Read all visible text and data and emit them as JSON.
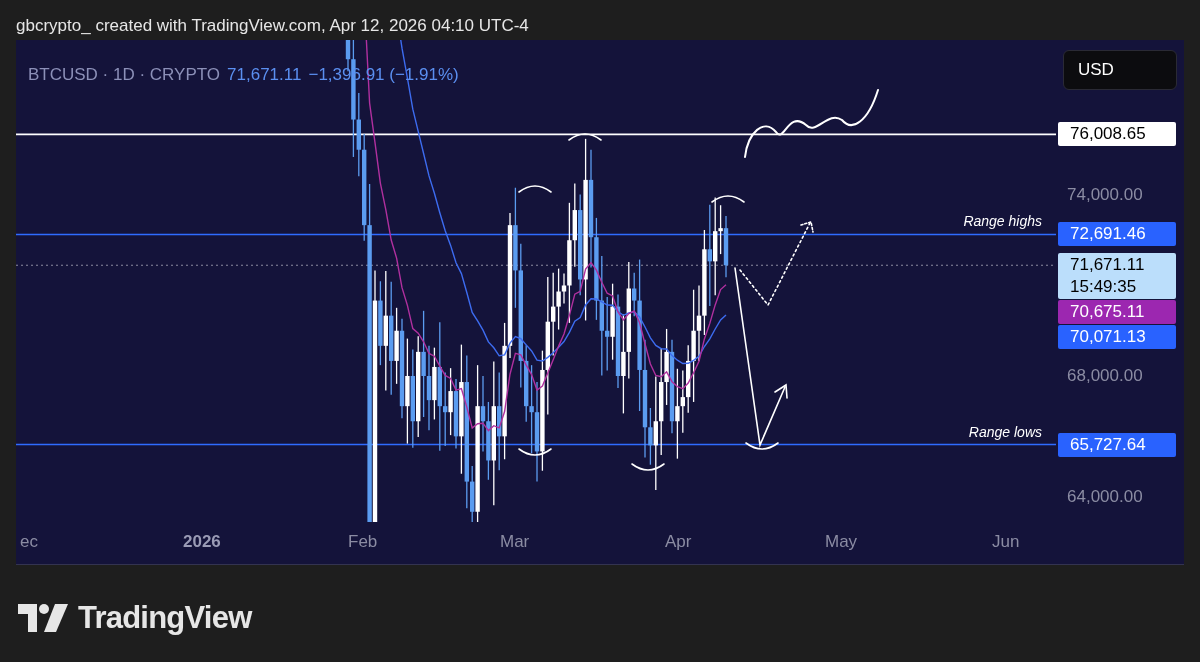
{
  "header": {
    "caption": "gbcrypto_ created with TradingView.com, Apr 12, 2026 04:10 UTC-4"
  },
  "legend": {
    "symbol": "BTCUSD · 1D · CRYPTO",
    "price": "71,671.11",
    "change": "−1,396.91 (−1.91%)"
  },
  "currency_button": "USD",
  "price_axis": {
    "ticks": [
      "74,000.00",
      "68,000.00",
      "64,000.00"
    ]
  },
  "price_labels": [
    {
      "text": "76,008.65",
      "kind": "level"
    },
    {
      "text": "72,691.46",
      "kind": "range",
      "line_label": "Range highs"
    },
    {
      "text": "71,671.11",
      "subtext": "15:49:35",
      "kind": "last"
    },
    {
      "text": "70,675.11",
      "kind": "ma_fast"
    },
    {
      "text": "70,071.13",
      "kind": "ma_slow"
    },
    {
      "text": "65,727.64",
      "kind": "range",
      "line_label": "Range lows"
    }
  ],
  "time_axis": [
    {
      "text": "ec",
      "kind": "month"
    },
    {
      "text": "2026",
      "kind": "year"
    },
    {
      "text": "Feb",
      "kind": "month"
    },
    {
      "text": "Mar",
      "kind": "month"
    },
    {
      "text": "Apr",
      "kind": "month"
    },
    {
      "text": "May",
      "kind": "month"
    },
    {
      "text": "Jun",
      "kind": "month"
    }
  ],
  "footer": {
    "brand": "TradingView"
  }
}
